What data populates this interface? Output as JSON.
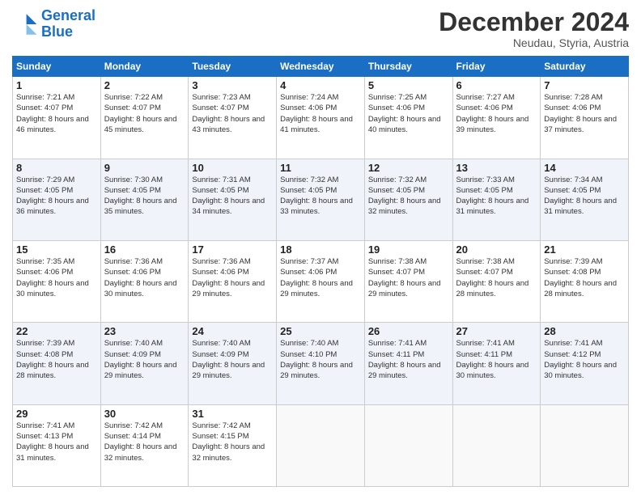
{
  "logo": {
    "line1": "General",
    "line2": "Blue"
  },
  "title": "December 2024",
  "subtitle": "Neudau, Styria, Austria",
  "days_of_week": [
    "Sunday",
    "Monday",
    "Tuesday",
    "Wednesday",
    "Thursday",
    "Friday",
    "Saturday"
  ],
  "weeks": [
    [
      {
        "day": "1",
        "sunrise": "7:21 AM",
        "sunset": "4:07 PM",
        "daylight": "8 hours and 46 minutes."
      },
      {
        "day": "2",
        "sunrise": "7:22 AM",
        "sunset": "4:07 PM",
        "daylight": "8 hours and 45 minutes."
      },
      {
        "day": "3",
        "sunrise": "7:23 AM",
        "sunset": "4:07 PM",
        "daylight": "8 hours and 43 minutes."
      },
      {
        "day": "4",
        "sunrise": "7:24 AM",
        "sunset": "4:06 PM",
        "daylight": "8 hours and 41 minutes."
      },
      {
        "day": "5",
        "sunrise": "7:25 AM",
        "sunset": "4:06 PM",
        "daylight": "8 hours and 40 minutes."
      },
      {
        "day": "6",
        "sunrise": "7:27 AM",
        "sunset": "4:06 PM",
        "daylight": "8 hours and 39 minutes."
      },
      {
        "day": "7",
        "sunrise": "7:28 AM",
        "sunset": "4:06 PM",
        "daylight": "8 hours and 37 minutes."
      }
    ],
    [
      {
        "day": "8",
        "sunrise": "7:29 AM",
        "sunset": "4:05 PM",
        "daylight": "8 hours and 36 minutes."
      },
      {
        "day": "9",
        "sunrise": "7:30 AM",
        "sunset": "4:05 PM",
        "daylight": "8 hours and 35 minutes."
      },
      {
        "day": "10",
        "sunrise": "7:31 AM",
        "sunset": "4:05 PM",
        "daylight": "8 hours and 34 minutes."
      },
      {
        "day": "11",
        "sunrise": "7:32 AM",
        "sunset": "4:05 PM",
        "daylight": "8 hours and 33 minutes."
      },
      {
        "day": "12",
        "sunrise": "7:32 AM",
        "sunset": "4:05 PM",
        "daylight": "8 hours and 32 minutes."
      },
      {
        "day": "13",
        "sunrise": "7:33 AM",
        "sunset": "4:05 PM",
        "daylight": "8 hours and 31 minutes."
      },
      {
        "day": "14",
        "sunrise": "7:34 AM",
        "sunset": "4:05 PM",
        "daylight": "8 hours and 31 minutes."
      }
    ],
    [
      {
        "day": "15",
        "sunrise": "7:35 AM",
        "sunset": "4:06 PM",
        "daylight": "8 hours and 30 minutes."
      },
      {
        "day": "16",
        "sunrise": "7:36 AM",
        "sunset": "4:06 PM",
        "daylight": "8 hours and 30 minutes."
      },
      {
        "day": "17",
        "sunrise": "7:36 AM",
        "sunset": "4:06 PM",
        "daylight": "8 hours and 29 minutes."
      },
      {
        "day": "18",
        "sunrise": "7:37 AM",
        "sunset": "4:06 PM",
        "daylight": "8 hours and 29 minutes."
      },
      {
        "day": "19",
        "sunrise": "7:38 AM",
        "sunset": "4:07 PM",
        "daylight": "8 hours and 29 minutes."
      },
      {
        "day": "20",
        "sunrise": "7:38 AM",
        "sunset": "4:07 PM",
        "daylight": "8 hours and 28 minutes."
      },
      {
        "day": "21",
        "sunrise": "7:39 AM",
        "sunset": "4:08 PM",
        "daylight": "8 hours and 28 minutes."
      }
    ],
    [
      {
        "day": "22",
        "sunrise": "7:39 AM",
        "sunset": "4:08 PM",
        "daylight": "8 hours and 28 minutes."
      },
      {
        "day": "23",
        "sunrise": "7:40 AM",
        "sunset": "4:09 PM",
        "daylight": "8 hours and 29 minutes."
      },
      {
        "day": "24",
        "sunrise": "7:40 AM",
        "sunset": "4:09 PM",
        "daylight": "8 hours and 29 minutes."
      },
      {
        "day": "25",
        "sunrise": "7:40 AM",
        "sunset": "4:10 PM",
        "daylight": "8 hours and 29 minutes."
      },
      {
        "day": "26",
        "sunrise": "7:41 AM",
        "sunset": "4:11 PM",
        "daylight": "8 hours and 29 minutes."
      },
      {
        "day": "27",
        "sunrise": "7:41 AM",
        "sunset": "4:11 PM",
        "daylight": "8 hours and 30 minutes."
      },
      {
        "day": "28",
        "sunrise": "7:41 AM",
        "sunset": "4:12 PM",
        "daylight": "8 hours and 30 minutes."
      }
    ],
    [
      {
        "day": "29",
        "sunrise": "7:41 AM",
        "sunset": "4:13 PM",
        "daylight": "8 hours and 31 minutes."
      },
      {
        "day": "30",
        "sunrise": "7:42 AM",
        "sunset": "4:14 PM",
        "daylight": "8 hours and 32 minutes."
      },
      {
        "day": "31",
        "sunrise": "7:42 AM",
        "sunset": "4:15 PM",
        "daylight": "8 hours and 32 minutes."
      },
      null,
      null,
      null,
      null
    ]
  ]
}
